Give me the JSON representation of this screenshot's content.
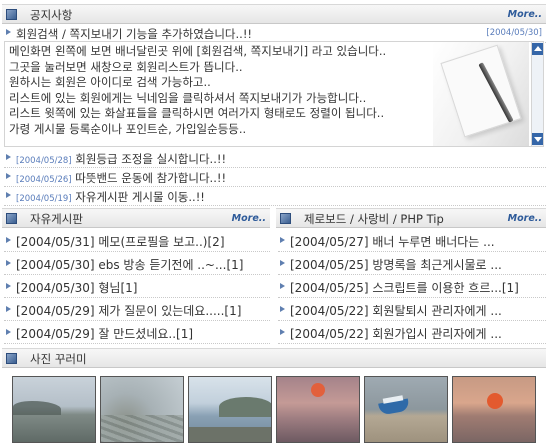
{
  "notice": {
    "title": "공지사항",
    "more": "More..",
    "featured": {
      "title": "회원검색 / 쪽지보내기 기능을 추가하였습니다..!!",
      "date": "[2004/05/30]"
    },
    "body_lines": [
      "메인화면 왼쪽에 보면 배너달린곳 위에 [회원검색, 쪽지보내기] 라고 있습니다..",
      "그곳을 눌러보면 새창으로 회원리스트가 뜹니다..",
      "원하시는 회원은 아이디로 검색 가능하고..",
      "리스트에 있는 회원에게는 닉네임을 클릭하셔서 쪽지보내기가 가능합니다..",
      "리스트 윗쪽에 있는 화살표들을 클릭하시면 여러가지 형태로도 정렬이 됩니다..",
      "가령 게시물 등록순이나 포인트순, 가입일순등등.."
    ],
    "items": [
      {
        "date": "[2004/05/28]",
        "title": "회원등급 조정을 실시합니다..!!"
      },
      {
        "date": "[2004/05/26]",
        "title": "따뜻밴드 운동에 참가합니다..!!"
      },
      {
        "date": "[2004/05/19]",
        "title": "자유게시판 게시물 이동..!!"
      }
    ]
  },
  "free_board": {
    "title": "자유게시판",
    "more": "More..",
    "items": [
      {
        "date": "[2004/05/31]",
        "title": "메모(프로필을 보고..)",
        "count": "[2]"
      },
      {
        "date": "[2004/05/30]",
        "title": "ebs 방송 듣기전에 ..~...",
        "count": "[1]"
      },
      {
        "date": "[2004/05/30]",
        "title": "형님",
        "count": "[1]"
      },
      {
        "date": "[2004/05/29]",
        "title": "제가 질문이 있는데요.....",
        "count": "[1]"
      },
      {
        "date": "[2004/05/29]",
        "title": "잘 만드셨네요..",
        "count": "[1]"
      }
    ]
  },
  "zero_board": {
    "title": "제로보드 / 사랑비 / PHP Tip",
    "more": "More..",
    "items": [
      {
        "date": "[2004/05/27]",
        "title": "배너 누루면 배너다는 ...",
        "count": ""
      },
      {
        "date": "[2004/05/25]",
        "title": "방명록을 최근게시물로 ...",
        "count": ""
      },
      {
        "date": "[2004/05/25]",
        "title": "스크립트를 이용한 흐르...",
        "count": "[1]"
      },
      {
        "date": "[2004/05/22]",
        "title": "회원탈퇴시 관리자에게 ...",
        "count": ""
      },
      {
        "date": "[2004/05/22]",
        "title": "회원가입시 관리자에게 ...",
        "count": ""
      }
    ]
  },
  "photos": {
    "title": "사진 꾸러미",
    "items": [
      {
        "scene": "misty-coast"
      },
      {
        "scene": "rocky-shore"
      },
      {
        "scene": "island-bay"
      },
      {
        "scene": "pink-sunset"
      },
      {
        "scene": "boat-beach"
      },
      {
        "scene": "orange-sunset"
      }
    ]
  },
  "colors": {
    "accent": "#2e5b9a",
    "date_blue": "#5a7dbb",
    "scroll_blue": "#3566a8"
  }
}
